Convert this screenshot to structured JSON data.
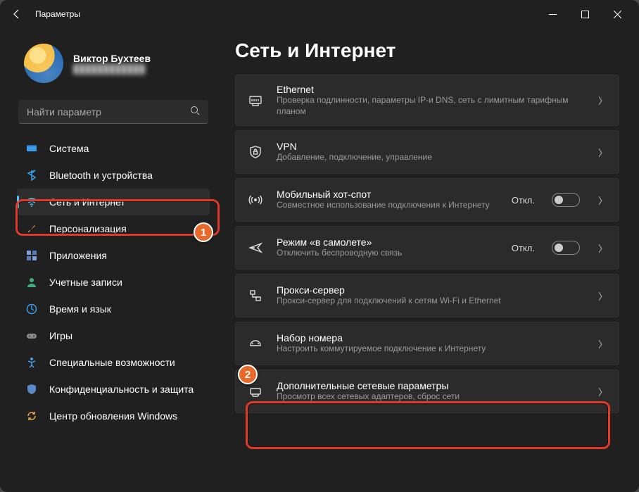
{
  "window": {
    "title": "Параметры"
  },
  "user": {
    "name": "Виктор Бухтеев",
    "email_masked": "████████████"
  },
  "search": {
    "placeholder": "Найти параметр"
  },
  "sidebar": {
    "items": [
      {
        "label": "Система"
      },
      {
        "label": "Bluetooth и устройства"
      },
      {
        "label": "Сеть и Интернет"
      },
      {
        "label": "Персонализация"
      },
      {
        "label": "Приложения"
      },
      {
        "label": "Учетные записи"
      },
      {
        "label": "Время и язык"
      },
      {
        "label": "Игры"
      },
      {
        "label": "Специальные возможности"
      },
      {
        "label": "Конфиденциальность и защита"
      },
      {
        "label": "Центр обновления Windows"
      }
    ]
  },
  "page": {
    "title": "Сеть и Интернет"
  },
  "cards": [
    {
      "title": "Ethernet",
      "sub": "Проверка подлинности, параметры IP-и DNS, сеть с лимитным тарифным планом"
    },
    {
      "title": "VPN",
      "sub": "Добавление, подключение, управление"
    },
    {
      "title": "Мобильный хот-спот",
      "sub": "Совместное использование подключения к Интернету",
      "status": "Откл."
    },
    {
      "title": "Режим «в самолете»",
      "sub": "Отключить беспроводную связь",
      "status": "Откл."
    },
    {
      "title": "Прокси-сервер",
      "sub": "Прокси-сервер для подключений к сетям Wi-Fi и Ethernet"
    },
    {
      "title": "Набор номера",
      "sub": "Настроить коммутируемое подключение к Интернету"
    },
    {
      "title": "Дополнительные сетевые параметры",
      "sub": "Просмотр всех сетевых адаптеров, сброс сети"
    }
  ],
  "annotations": {
    "badge1": "1",
    "badge2": "2"
  }
}
